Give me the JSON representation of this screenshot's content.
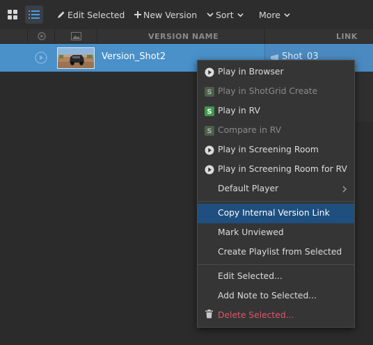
{
  "toolbar": {
    "edit_selected": "Edit Selected",
    "new_version": "New Version",
    "sort": "Sort",
    "more": "More"
  },
  "header": {
    "version_name": "VERSION NAME",
    "link": "LINK"
  },
  "row": {
    "name": "Version_Shot2",
    "link": "Shot_03"
  },
  "menu": {
    "items": [
      {
        "label": "Play in Browser",
        "icon": "play-circle-icon"
      },
      {
        "label": "Play in ShotGrid Create",
        "icon": "shotgrid-icon",
        "state": "disabled"
      },
      {
        "label": "Play in RV",
        "icon": "shotgrid-rv-icon"
      },
      {
        "label": "Compare in RV",
        "icon": "shotgrid-rv-icon",
        "state": "disabled"
      },
      {
        "label": "Play in Screening Room",
        "icon": "play-circle-icon"
      },
      {
        "label": "Play in Screening Room for RV",
        "icon": "play-circle-icon"
      },
      {
        "label": "Default Player",
        "icon": "chevron-right-icon"
      },
      {
        "label": "Copy Internal Version Link",
        "state": "highlighted"
      },
      {
        "label": "Mark Unviewed"
      },
      {
        "label": "Create Playlist from Selected"
      },
      {
        "label": "Edit Selected..."
      },
      {
        "label": "Add Note to Selected..."
      },
      {
        "label": "Delete Selected...",
        "icon": "trash-icon",
        "state": "danger"
      }
    ]
  },
  "colors": {
    "selection": "#4a90c9",
    "highlight": "#1e4f7f",
    "danger": "#e0566b",
    "shotgrid_green": "#3e9a4a"
  }
}
